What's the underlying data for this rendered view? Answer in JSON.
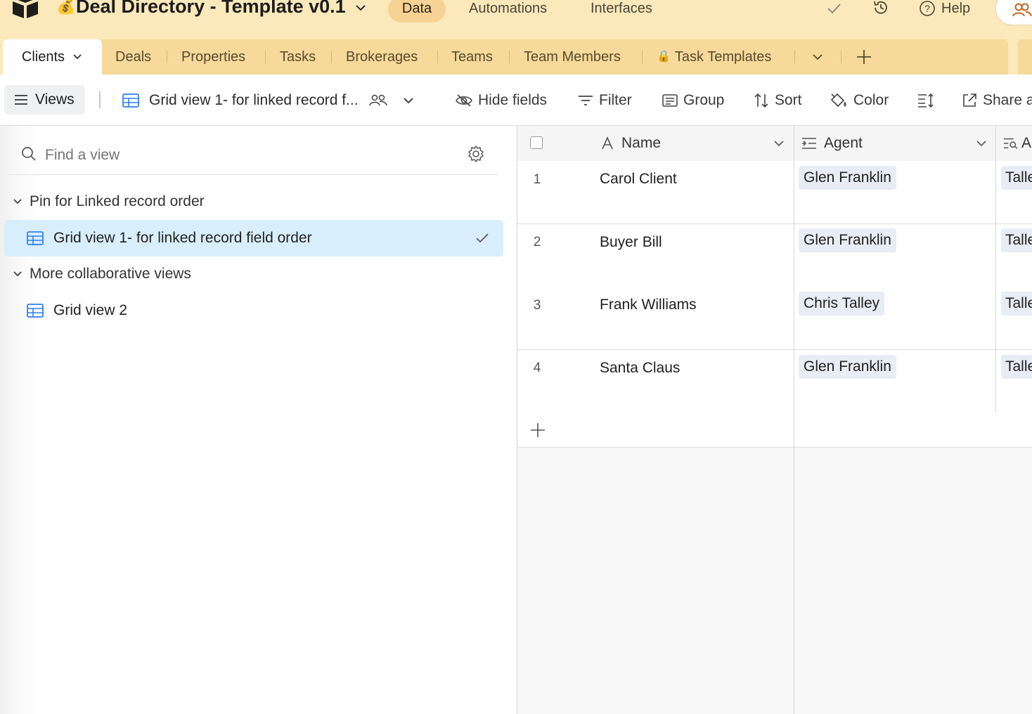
{
  "header": {
    "base_emoji": "💰",
    "base_title": "Deal Directory - Template v0.1",
    "nav": [
      {
        "label": "Data",
        "active": true
      },
      {
        "label": "Automations"
      },
      {
        "label": "Interfaces"
      }
    ],
    "help_label": "Help"
  },
  "tables": {
    "tabs": [
      "Clients",
      "Deals",
      "Properties",
      "Tasks",
      "Brokerages",
      "Teams",
      "Team Members",
      "Task Templates"
    ],
    "active": "Clients",
    "locked_tab_icon": "🔒"
  },
  "viewbar": {
    "views_label": "Views",
    "current_view": "Grid view 1- for linked record f...",
    "hide_fields": "Hide fields",
    "filter": "Filter",
    "group": "Group",
    "sort": "Sort",
    "color": "Color",
    "share": "Share a"
  },
  "sidebar": {
    "search_placeholder": "Find a view",
    "sections": [
      {
        "title": "Pin for Linked record order",
        "views": [
          "Grid view 1- for linked record field order"
        ]
      },
      {
        "title": "More collaborative views",
        "views": [
          "Grid view 2"
        ]
      }
    ],
    "active_view": "Grid view 1- for linked record field order"
  },
  "grid": {
    "columns": [
      "Name",
      "Agent",
      "A"
    ],
    "rows": [
      {
        "num": "1",
        "name": "Carol Client",
        "agent": "Glen Franklin",
        "col3": "Talle"
      },
      {
        "num": "2",
        "name": "Buyer Bill",
        "agent": "Glen Franklin",
        "col3": "Talle"
      },
      {
        "num": "3",
        "name": "Frank Williams",
        "agent": "Chris Talley",
        "col3": "Talle"
      },
      {
        "num": "4",
        "name": "Santa Claus",
        "agent": "Glen Franklin",
        "col3": "Talle"
      }
    ]
  },
  "colors": {
    "header_bg": "#fbe9bb",
    "active_pill": "#f6d294",
    "selected_view": "#d8eefb",
    "link_pill": "#e8ecf5",
    "grid_icon_blue": "#2d7ff9"
  }
}
